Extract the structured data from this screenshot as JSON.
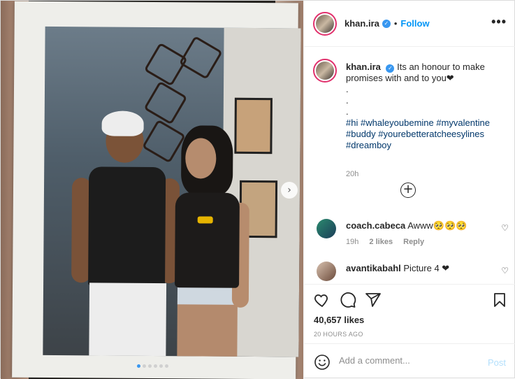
{
  "header": {
    "username": "khan.ira",
    "separator": "•",
    "follow_label": "Follow",
    "more_label": "•••"
  },
  "media": {
    "next_icon": "chevron-right-icon",
    "next_glyph": "›",
    "carousel_index": 1,
    "carousel_count": 6
  },
  "caption": {
    "username": "khan.ira",
    "text": "Its an honour to make promises with and to you❤",
    "line2": ".",
    "line3": ".",
    "line4": ".",
    "hashtags": "#hi #whaleyoubemine #myvalentine #buddy #yourebetteratcheesylines #dreamboy",
    "time": "20h"
  },
  "load_more_glyph": "+",
  "comments": [
    {
      "username": "coach.cabeca",
      "text": "Awww🥺🥺🥺",
      "time": "19h",
      "likes": "2 likes",
      "reply": "Reply"
    },
    {
      "username": "avantikabahl",
      "text": "Picture 4 ❤"
    }
  ],
  "heart_glyph": "♡",
  "actions": {
    "likes": "40,657 likes",
    "ago": "20 HOURS AGO"
  },
  "add_comment": {
    "placeholder": "Add a comment...",
    "post_label": "Post"
  },
  "colors": {
    "accent": "#0095f6",
    "verified": "#3897f0",
    "post_disabled": "#b2dffc",
    "hashtag": "#00376b",
    "muted": "#8e8e8e"
  }
}
